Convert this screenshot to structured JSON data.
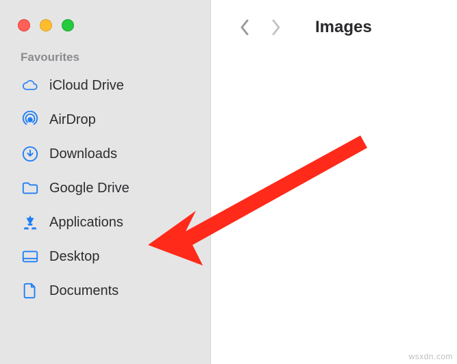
{
  "colors": {
    "accent": "#1e7ef5",
    "sidebar_bg": "#e5e5e6",
    "text": "#2c2c2e",
    "section_title": "#8b8b8f",
    "annotation": "#ff2a1a"
  },
  "sidebar": {
    "section_title": "Favourites",
    "items": [
      {
        "icon": "cloud-icon",
        "label": "iCloud Drive"
      },
      {
        "icon": "airdrop-icon",
        "label": "AirDrop"
      },
      {
        "icon": "download-icon",
        "label": "Downloads"
      },
      {
        "icon": "folder-icon",
        "label": "Google Drive"
      },
      {
        "icon": "appstore-icon",
        "label": "Applications"
      },
      {
        "icon": "desktop-icon",
        "label": "Desktop"
      },
      {
        "icon": "document-icon",
        "label": "Documents"
      }
    ]
  },
  "toolbar": {
    "title": "Images"
  },
  "watermark": "wsxdn.com"
}
